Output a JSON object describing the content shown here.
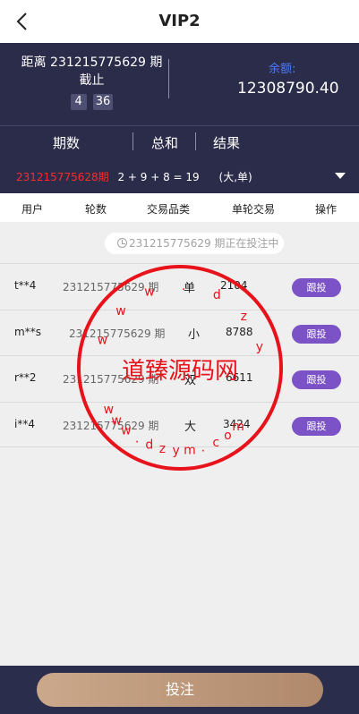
{
  "header": {
    "title": "VIP2"
  },
  "info": {
    "period_text": "距离 231215775629 期",
    "deadline_label": "截止",
    "countdown": [
      "4",
      "36"
    ],
    "balance_label": "余额:",
    "balance_value": "12308790.40"
  },
  "history": {
    "headers": [
      "期数",
      "总和",
      "结果"
    ],
    "latest": {
      "period": "231215775628期",
      "formula": "2 + 9 + 8 = 19",
      "result": "(大,单)"
    }
  },
  "columns": [
    "用户",
    "轮数",
    "交易品类",
    "单轮交易",
    "操作"
  ],
  "notice": "231215775629 期正在投注中",
  "bets": [
    {
      "user": "t**4",
      "period": "231215775629 期",
      "type": "单",
      "amount": "2104",
      "action": "跟投"
    },
    {
      "user": "m**s",
      "period": "231215775629 期",
      "type": "小",
      "amount": "8788",
      "action": "跟投"
    },
    {
      "user": "r**2",
      "period": "231215775629 期",
      "type": "双",
      "amount": "6611",
      "action": "跟投"
    },
    {
      "user": "i**4",
      "period": "231215775629 期",
      "type": "大",
      "amount": "3424",
      "action": "跟投"
    }
  ],
  "submit_label": "投注",
  "watermark": {
    "text": "道臻源码网",
    "url": "www.dzym.com",
    "color": "#e8121b"
  }
}
